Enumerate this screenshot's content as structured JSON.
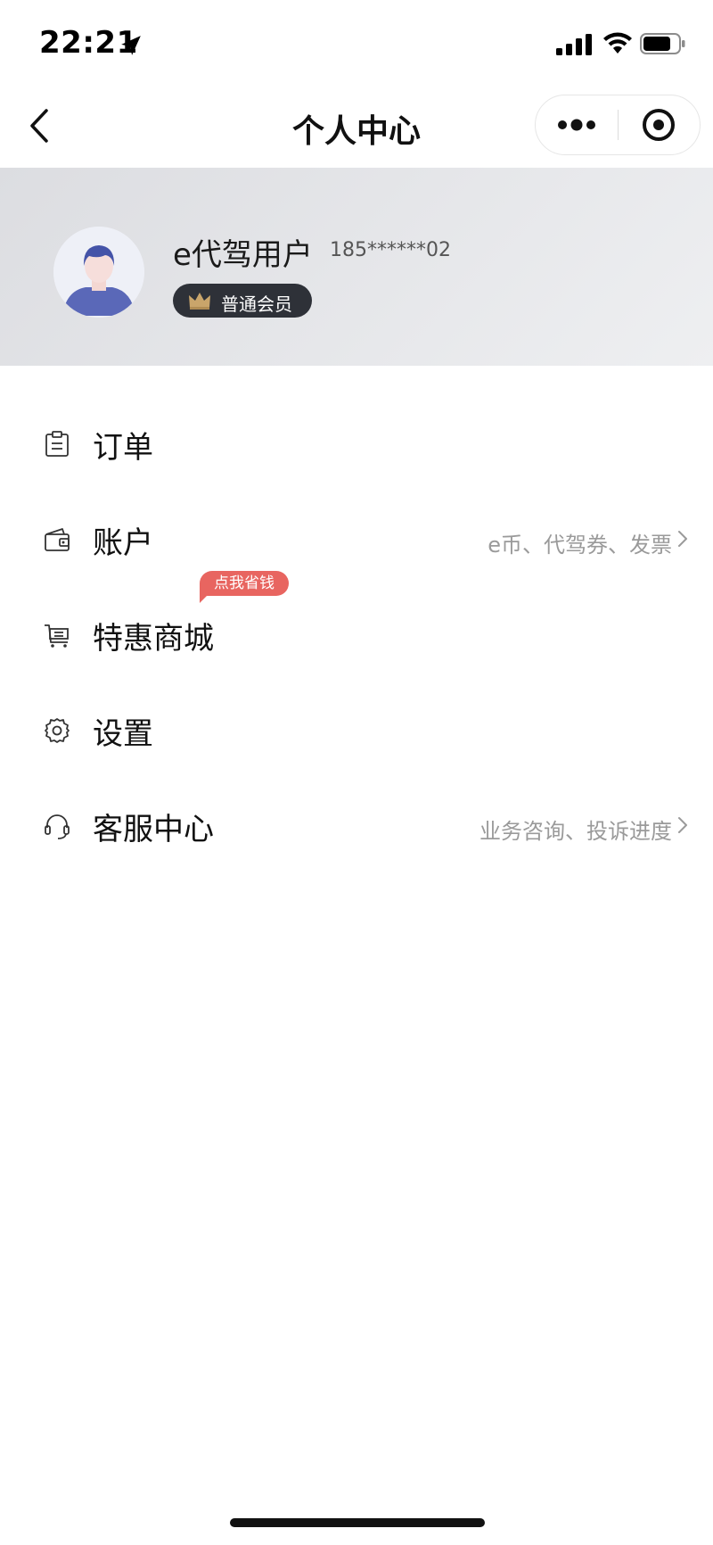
{
  "status_bar": {
    "time": "22:21",
    "icons": [
      "location-arrow-icon",
      "signal-icon",
      "wifi-icon",
      "battery-icon"
    ]
  },
  "nav": {
    "title": "个人中心",
    "icons": [
      "back-chevron-icon",
      "more-dots-icon",
      "target-circle-icon"
    ]
  },
  "profile": {
    "name": "e代驾用户",
    "phone": "185******02",
    "member_level": "普通会员"
  },
  "menu": {
    "items": [
      {
        "label": "订单",
        "icon": "clipboard-icon",
        "hint": ""
      },
      {
        "label": "账户",
        "icon": "wallet-icon",
        "hint": "e币、代驾券、发票"
      },
      {
        "label": "特惠商城",
        "icon": "cart-icon",
        "hint": "",
        "badge": "点我省钱"
      },
      {
        "label": "设置",
        "icon": "gear-icon",
        "hint": ""
      },
      {
        "label": "客服中心",
        "icon": "headset-icon",
        "hint": "业务咨询、投诉进度"
      }
    ]
  },
  "colors": {
    "header_bg": "#e3e4e7",
    "badge_bg": "#2e3138",
    "promo_bg": "#e86560",
    "hint_text": "#9a9a9a",
    "avatar_accent": "#5a68b8"
  }
}
